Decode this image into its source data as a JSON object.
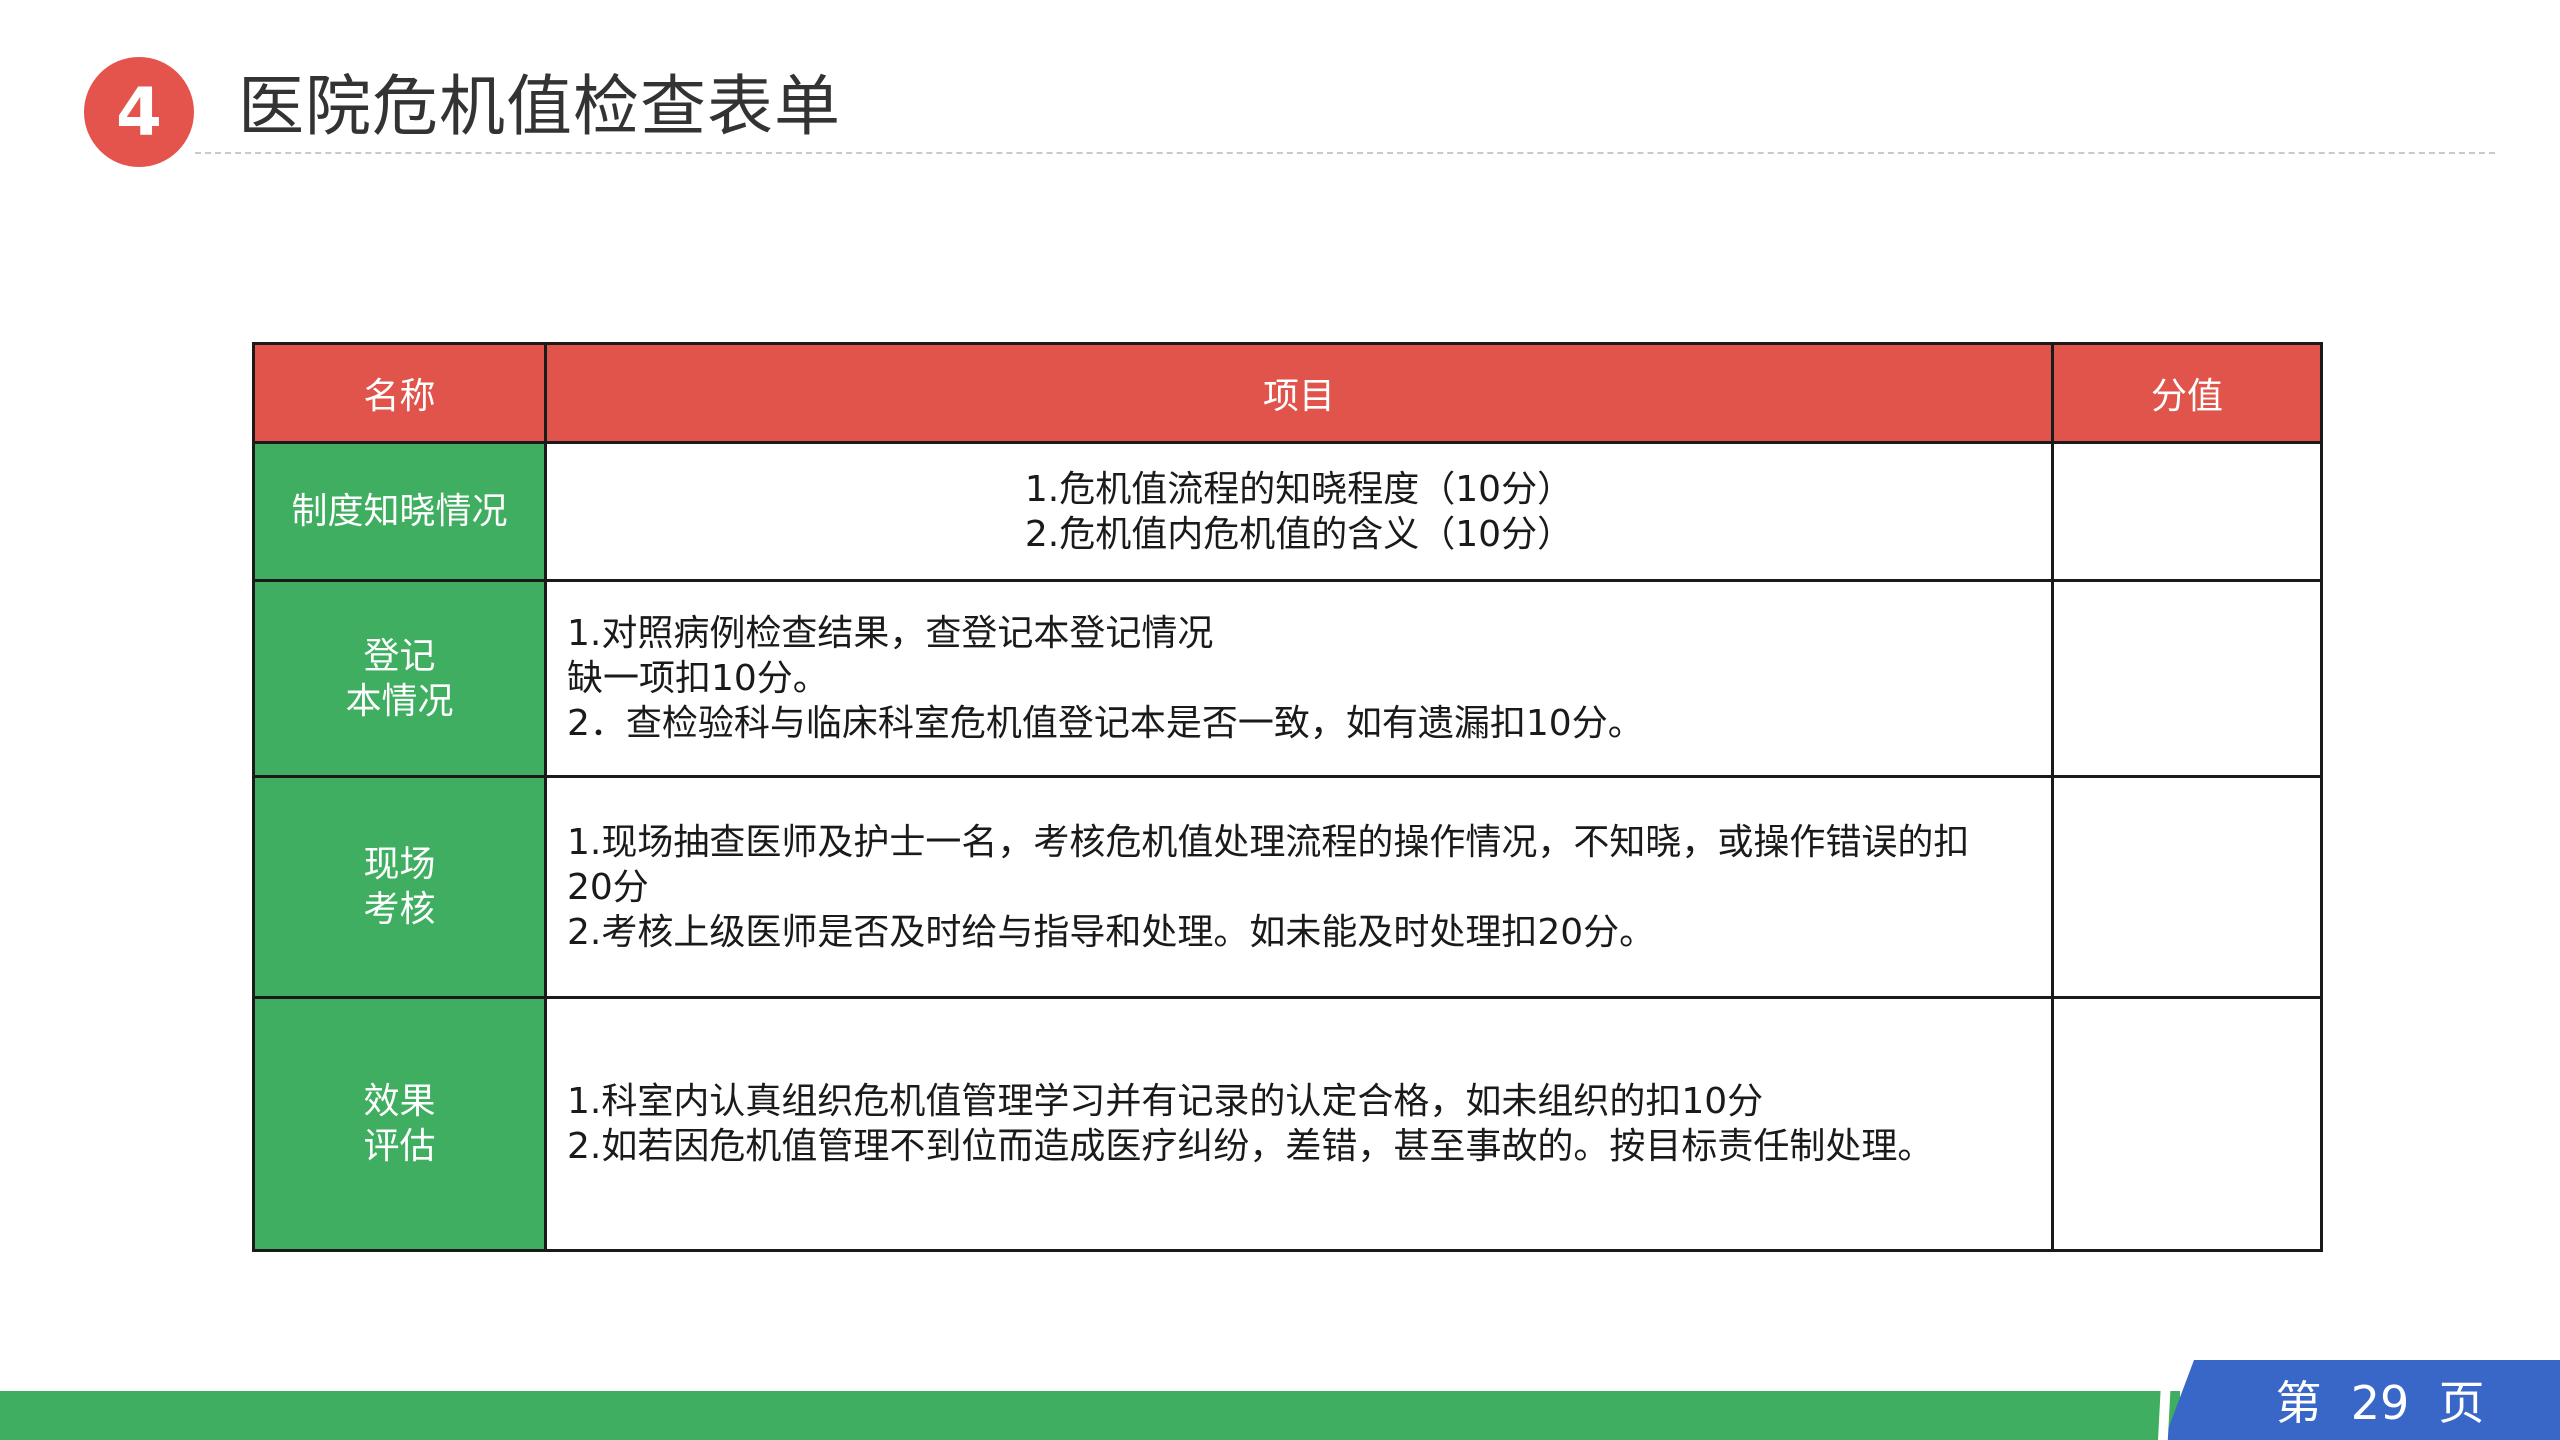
{
  "header": {
    "section_number": "4",
    "title": "医院危机值检查表单"
  },
  "table": {
    "columns": [
      "名称",
      "项目",
      "分值"
    ],
    "rows": [
      {
        "name_lines": [
          "制度知晓情况"
        ],
        "item_lines": [
          "1.危机值流程的知晓程度（10分）",
          "2.危机值内危机值的含义（10分）"
        ],
        "score": ""
      },
      {
        "name_lines": [
          "登记",
          "本情况"
        ],
        "item_lines": [
          "1.对照病例检查结果，查登记本登记情况",
          "缺一项扣10分。",
          "2．查检验科与临床科室危机值登记本是否一致，如有遗漏扣10分。"
        ],
        "score": ""
      },
      {
        "name_lines": [
          "现场",
          "考核"
        ],
        "item_lines": [
          "1.现场抽查医师及护士一名，考核危机值处理流程的操作情况，不知晓，或操作错误的扣",
          "20分",
          "2.考核上级医师是否及时给与指导和处理。如未能及时处理扣20分。"
        ],
        "score": ""
      },
      {
        "name_lines": [
          "效果",
          "评估"
        ],
        "item_lines": [
          "1.科室内认真组织危机值管理学习并有记录的认定合格，如未组织的扣10分",
          "2.如若因危机值管理不到位而造成医疗纠纷，差错，甚至事故的。按目标责任制处理。"
        ],
        "score": ""
      }
    ]
  },
  "footer": {
    "page_label": "第  29  页"
  },
  "colors": {
    "accent_red": "#e0544b",
    "accent_green": "#3fae60",
    "accent_blue": "#3867c8"
  }
}
